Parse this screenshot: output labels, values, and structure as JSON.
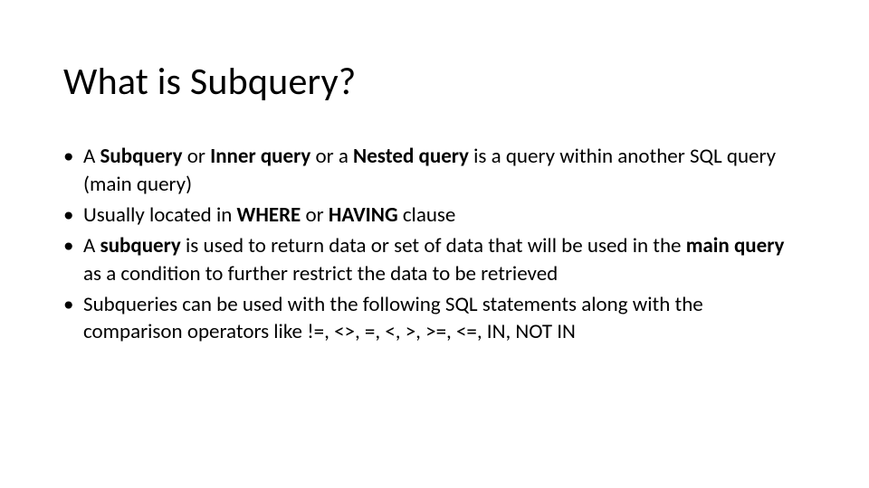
{
  "title": "What is Subquery?",
  "bullets": [
    {
      "runs": [
        {
          "t": "A ",
          "b": false
        },
        {
          "t": "Subquery",
          "b": true
        },
        {
          "t": " or ",
          "b": false
        },
        {
          "t": "Inner query",
          "b": true
        },
        {
          "t": " or a ",
          "b": false
        },
        {
          "t": "Nested query",
          "b": true
        },
        {
          "t": " is a query within another SQL query (main query)",
          "b": false
        }
      ]
    },
    {
      "runs": [
        {
          "t": "Usually located in ",
          "b": false
        },
        {
          "t": "WHERE",
          "b": true
        },
        {
          "t": " or ",
          "b": false
        },
        {
          "t": "HAVING",
          "b": true
        },
        {
          "t": " clause",
          "b": false
        }
      ]
    },
    {
      "runs": [
        {
          "t": "A ",
          "b": false
        },
        {
          "t": "subquery",
          "b": true
        },
        {
          "t": " is used to return data or set of data that will be used in the ",
          "b": false
        },
        {
          "t": "main query",
          "b": true
        },
        {
          "t": " as a condition to further restrict the data to be retrieved",
          "b": false
        }
      ]
    },
    {
      "runs": [
        {
          "t": "Subqueries can be used with the following SQL statements along with the comparison operators like !=, <>, =, <, >, >=, <=, IN, NOT IN",
          "b": false
        }
      ]
    }
  ]
}
